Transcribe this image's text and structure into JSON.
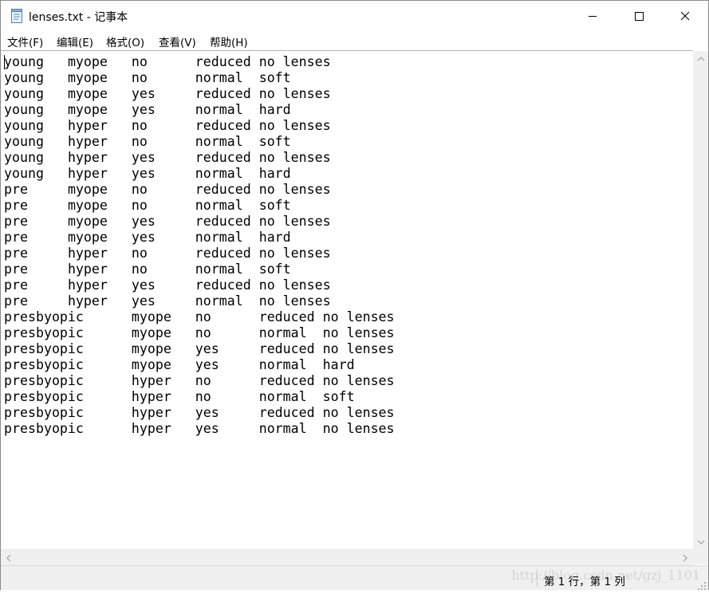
{
  "window": {
    "title": "lenses.txt - 记事本",
    "icon": "notepad-icon"
  },
  "menu": [
    {
      "label": "文件(F)"
    },
    {
      "label": "编辑(E)"
    },
    {
      "label": "格式(O)"
    },
    {
      "label": "查看(V)"
    },
    {
      "label": "帮助(H)"
    }
  ],
  "editor": {
    "content": "young\tmyope\tno\treduced\tno lenses\nyoung\tmyope\tno\tnormal\tsoft\nyoung\tmyope\tyes\treduced\tno lenses\nyoung\tmyope\tyes\tnormal\thard\nyoung\thyper\tno\treduced\tno lenses\nyoung\thyper\tno\tnormal\tsoft\nyoung\thyper\tyes\treduced\tno lenses\nyoung\thyper\tyes\tnormal\thard\npre\tmyope\tno\treduced\tno lenses\npre\tmyope\tno\tnormal\tsoft\npre\tmyope\tyes\treduced\tno lenses\npre\tmyope\tyes\tnormal\thard\npre\thyper\tno\treduced\tno lenses\npre\thyper\tno\tnormal\tsoft\npre\thyper\tyes\treduced\tno lenses\npre\thyper\tyes\tnormal\tno lenses\npresbyopic\tmyope\tno\treduced\tno lenses\npresbyopic\tmyope\tno\tnormal\tno lenses\npresbyopic\tmyope\tyes\treduced\tno lenses\npresbyopic\tmyope\tyes\tnormal\thard\npresbyopic\thyper\tno\treduced\tno lenses\npresbyopic\thyper\tno\tnormal\tsoft\npresbyopic\thyper\tyes\treduced\tno lenses\npresbyopic\thyper\tyes\tnormal\tno lenses"
  },
  "statusbar": {
    "position": "第 1 行，第 1 列",
    "watermark": "http://blog.csdn.net/gzj_1101"
  },
  "colors": {
    "chrome": "#f0f0f0",
    "border": "#8a8a8a",
    "text": "#000000"
  }
}
